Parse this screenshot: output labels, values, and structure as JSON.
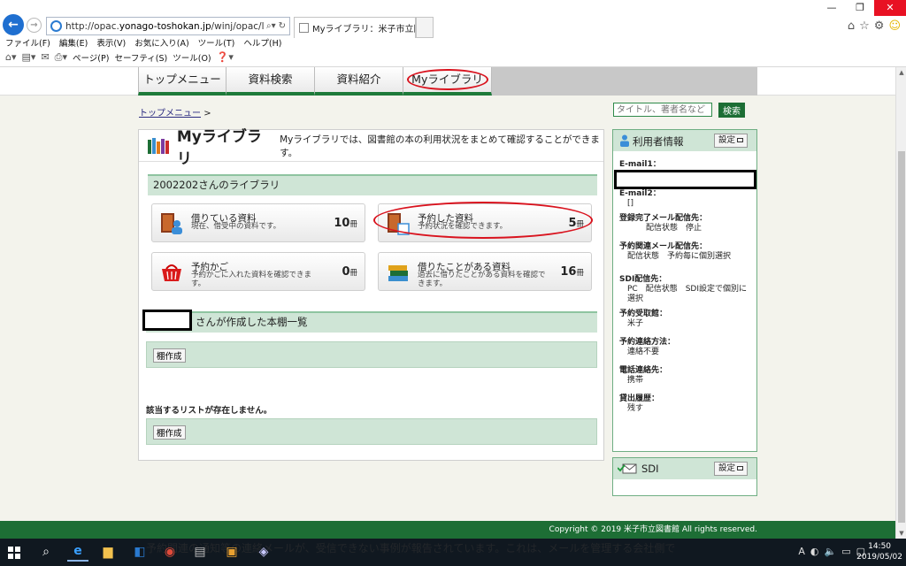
{
  "browser": {
    "url_prefix": "http://opac.",
    "url_domain": "yonago-toshokan.jp",
    "url_rest": "/winj/opac/login.do?dispa",
    "tab_title": "Myライブラリ：米子市立図書館",
    "menu": [
      "ファイル(F)",
      "編集(E)",
      "表示(V)",
      "お気に入り(A)",
      "ツール(T)",
      "ヘルプ(H)"
    ],
    "commands": [
      "ページ(P)",
      "セーフティ(S)",
      "ツール(O)"
    ]
  },
  "nav": {
    "items": [
      "トップメニュー",
      "資料検索",
      "資料紹介",
      "Myライブラリ"
    ]
  },
  "breadcrumb": {
    "link": "トップメニュー",
    "sep": ">"
  },
  "search": {
    "placeholder": "タイトル、著者名など",
    "button": "検索"
  },
  "mylibrary": {
    "title": "Myライブラリ",
    "description": "Myライブラリでは、図書館の本の利用状況をまとめて確認することができます。",
    "owner_heading": "2002202さんのライブラリ",
    "tiles": [
      {
        "title": "借りている資料",
        "sub": "現在、借受中の資料です。",
        "count": "10",
        "unit": "冊"
      },
      {
        "title": "予約した資料",
        "sub": "予約状況を確認できます。",
        "count": "5",
        "unit": "冊"
      },
      {
        "title": "予約かご",
        "sub": "予約かごに入れた資料を確認できます。",
        "count": "0",
        "unit": "冊"
      },
      {
        "title": "借りたことがある資料",
        "sub": "過去に借りたことがある資料を確認できます。",
        "count": "16",
        "unit": "冊"
      }
    ],
    "shelf_heading": "さんが作成した本棚一覧",
    "shelf_button": "棚作成",
    "no_list": "該当するリストが存在しません。"
  },
  "user_panel": {
    "title": "利用者情報",
    "settings": "設定",
    "fields": [
      {
        "label": "E-mail1：",
        "value": ""
      },
      {
        "label": "E-mail2：",
        "value": "[]"
      },
      {
        "label": "登録完了メール配信先：",
        "value": "配信状態　停止"
      },
      {
        "label": "予約関連メール配信先：",
        "value": "配信状態　予約毎に個別選択"
      },
      {
        "label": "SDI配信先：",
        "value": "PC　配信状態　SDI設定で個別に選択"
      },
      {
        "label": "予約受取館：",
        "value": "米子"
      },
      {
        "label": "予約連絡方法：",
        "value": "連絡不要"
      },
      {
        "label": "電話連絡先：",
        "value": "携帯"
      },
      {
        "label": "貸出履歴：",
        "value": "残す"
      }
    ]
  },
  "sdi_panel": {
    "title": "SDI",
    "settings": "設定"
  },
  "footer": {
    "copyright": "Copyright © 2019 米子市立図書館 All rights reserved."
  },
  "taskbar": {
    "ticker": "予約関連の通知等の連絡メールが、受信できない事例が報告されています。これは、メールを管理する会社側で",
    "time": "14:50",
    "date": "2019/05/02"
  },
  "colors": {
    "brand_green": "#1d6e35",
    "light_green": "#cfe5d6",
    "highlight_red": "#d9131e"
  }
}
